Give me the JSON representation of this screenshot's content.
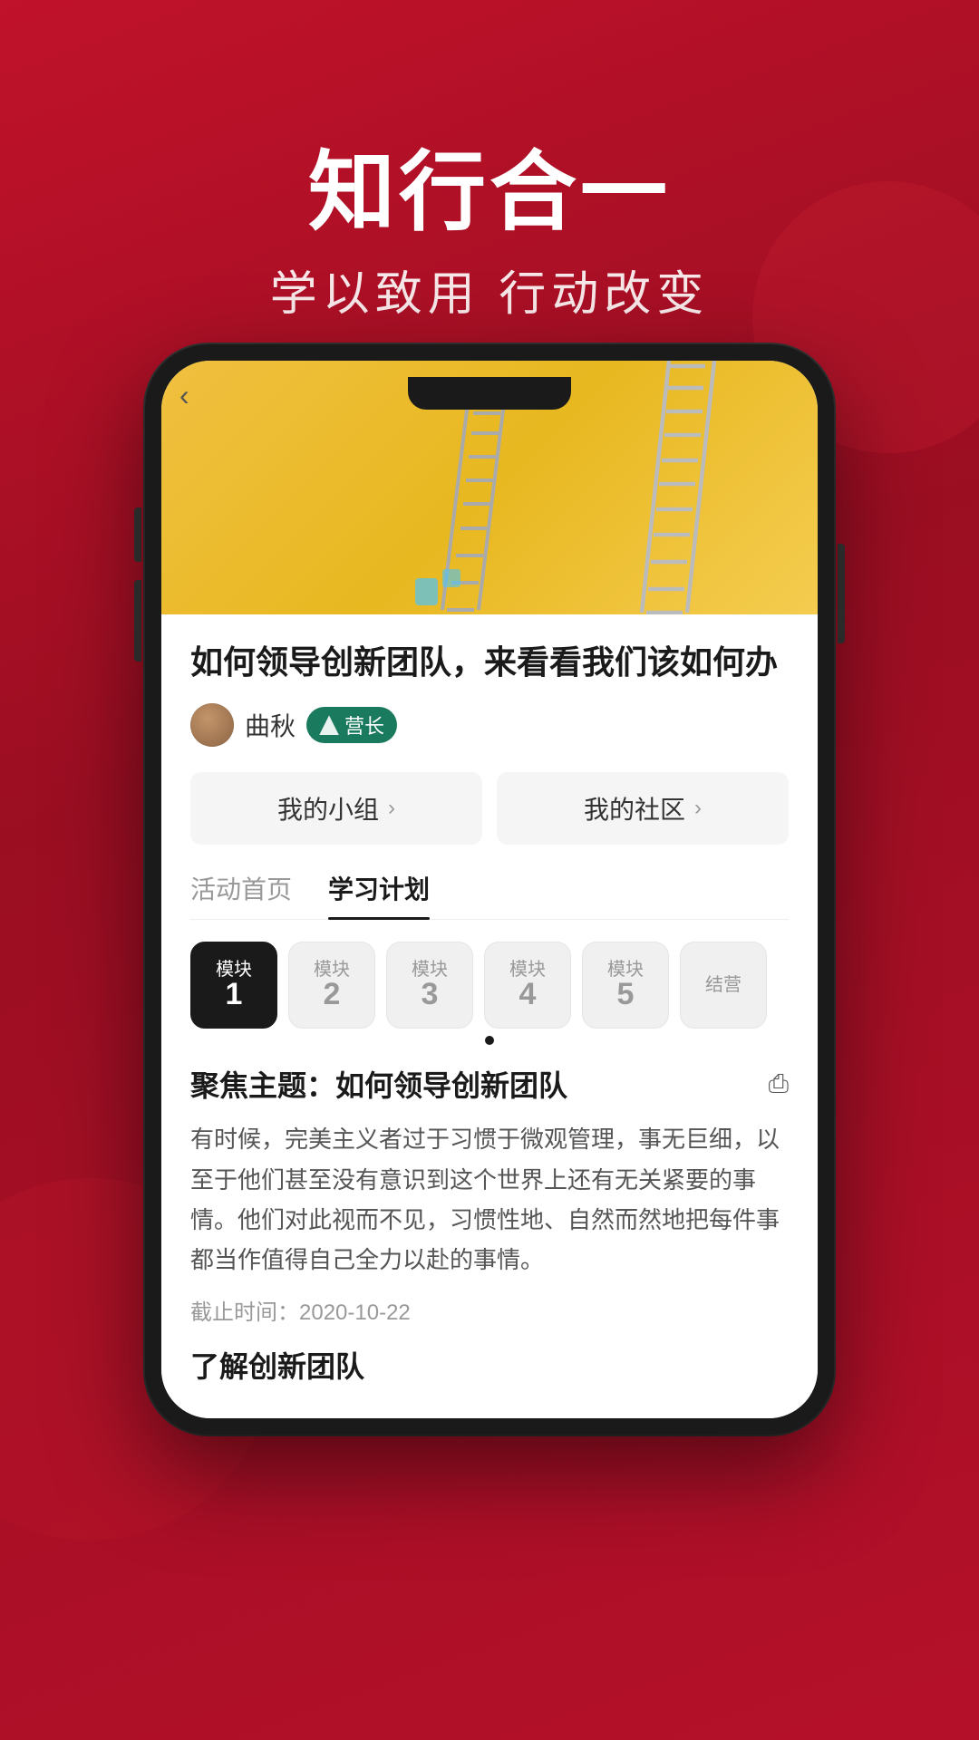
{
  "background": {
    "gradient_start": "#c0122a",
    "gradient_end": "#9b0e22"
  },
  "header": {
    "title": "知行合一",
    "subtitle": "学以致用 行动改变"
  },
  "phone": {
    "back_button": "‹",
    "hero_image_alt": "Yellow wall with ladders"
  },
  "article": {
    "title": "如何领导创新团队，来看看我们该如何办",
    "author_name": "曲秋",
    "author_badge": "营长",
    "nav_buttons": [
      {
        "label": "我的小组",
        "arrow": "›"
      },
      {
        "label": "我的社区",
        "arrow": "›"
      }
    ]
  },
  "tabs": [
    {
      "label": "活动首页",
      "active": false
    },
    {
      "label": "学习计划",
      "active": true
    }
  ],
  "modules": [
    {
      "label": "模块",
      "number": "1",
      "active": true
    },
    {
      "label": "模块",
      "number": "2",
      "active": false
    },
    {
      "label": "模块",
      "number": "3",
      "active": false
    },
    {
      "label": "模块",
      "number": "4",
      "active": false
    },
    {
      "label": "模块",
      "number": "5",
      "active": false
    },
    {
      "label": "结营",
      "number": "",
      "active": false
    }
  ],
  "focus": {
    "title": "聚焦主题：如何领导创新团队",
    "share_icon": "⎙",
    "body": "有时候，完美主义者过于习惯于微观管理，事无巨细，以至于他们甚至没有意识到这个世界上还有无关紧要的事情。他们对此视而不见，习惯性地、自然而然地把每件事都当作值得自己全力以赴的事情。",
    "deadline": "截止时间：2020-10-22",
    "section_title": "了解创新团队"
  }
}
